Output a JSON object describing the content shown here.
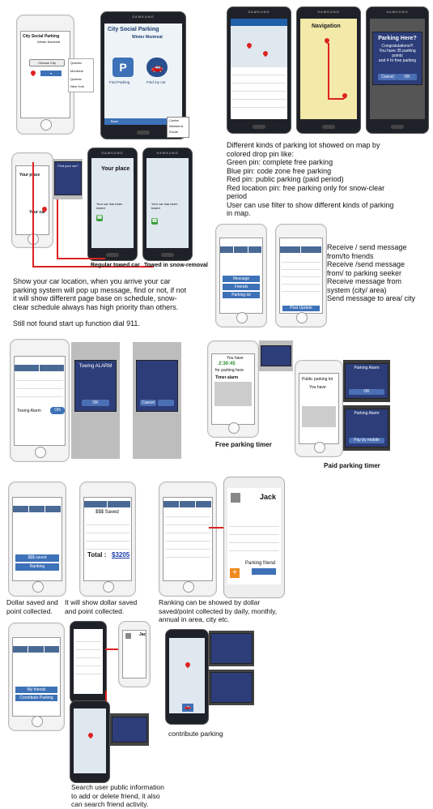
{
  "intro_screens": {
    "app_title": "City Social Parking",
    "app_subtitle": "Winter Montreal",
    "choose_city_button": "Choose City",
    "city_menu": [
      "Quebec",
      "Montreal",
      "Quebec",
      "New York"
    ],
    "find_parking_label": "Find Parking",
    "find_my_car_label": "Find my car",
    "footer_back": "Back",
    "footer_more": "More",
    "filter_menu": [
      "Center",
      "Weekend",
      "Social"
    ]
  },
  "navigation_screens": {
    "nav_title": "Navigation",
    "popup_title": "Parking Here?",
    "popup_line1": "Congratulations!!!",
    "popup_line2": "You have 35 parking points",
    "popup_line3": "and 4 hr free parking",
    "cancel": "Cancel",
    "ok": "OK"
  },
  "map_description": {
    "lines": [
      "Different kinds of parking lot showed on map by",
      "colored drop pin like:",
      "Green pin: complete free parking",
      "Blue pin: code zone free parking",
      "Red pin: public parking (paid period)",
      "Red location pin: free parking only for snow-clear",
      "period",
      "User can use filter to show different kinds of parking",
      "in map."
    ]
  },
  "towed_screens": {
    "your_place": "Your place",
    "your_car": "Your car",
    "found_question": "Find your car?",
    "your_car_towed": "Your car has been towed",
    "regular_caption": "Regular towed car",
    "snow_caption": "Towed in snow-removal"
  },
  "car_location_description": {
    "lines": [
      "Show your car location, when you arrive your car",
      "parking system will pop up message, find or not, if not",
      "it will show different page base on schedule, snow-",
      "clear schedule always has high priority than others."
    ],
    "line_911": "Still not found start up function dial 911."
  },
  "messages": {
    "menu_items": [
      "Message",
      "Friends",
      "Parking lot",
      "Post Update"
    ],
    "description": [
      "Receive / send message",
      "from/to friends",
      "Receive /send message",
      "from/ to parking seeker",
      "Receive message from",
      "system (city/ area)",
      "Send message to area/ city"
    ]
  },
  "alarm": {
    "toggle_label": "Towing Alarm",
    "toggle_value": "ON",
    "towing_title": "Towing ALARM",
    "ok": "OK"
  },
  "free_timer": {
    "caption": "Free parking timer",
    "you_have": "You have",
    "time": "2:30:45",
    "for_here": "for parking here",
    "timer_alarm": "Timer alarm"
  },
  "paid_timer": {
    "caption": "Paid parking  timer",
    "title": "Public parking lot",
    "you_have": "You have",
    "alarm_title": "Parking Alarm",
    "ok": "OK",
    "pay_by_mobile": "Pay by mobile"
  },
  "dollar": {
    "saved_button": "$$$ saved",
    "ranking_button": "Ranking",
    "saved_title": "$$$ Saved",
    "total_label": "Total :",
    "total_value": "$3205",
    "caption_left": [
      "Dollar saved and",
      "point collected."
    ],
    "caption_mid": [
      "It will show dollar saved",
      "and point collected."
    ]
  },
  "ranking": {
    "profile_name": "Jack",
    "parking_friend": "Parking friend",
    "caption": [
      "Ranking can be showed by dollar",
      "saved/point collected by daily, monthly,",
      "annual in area, city etc."
    ]
  },
  "friends": {
    "my_friends": "My friends",
    "contribute_button": "Contribute Parking",
    "caption": [
      "Search user public information",
      "to add or delete friend, it also",
      "can search friend activity."
    ],
    "contribute_caption": "contribute parking"
  }
}
